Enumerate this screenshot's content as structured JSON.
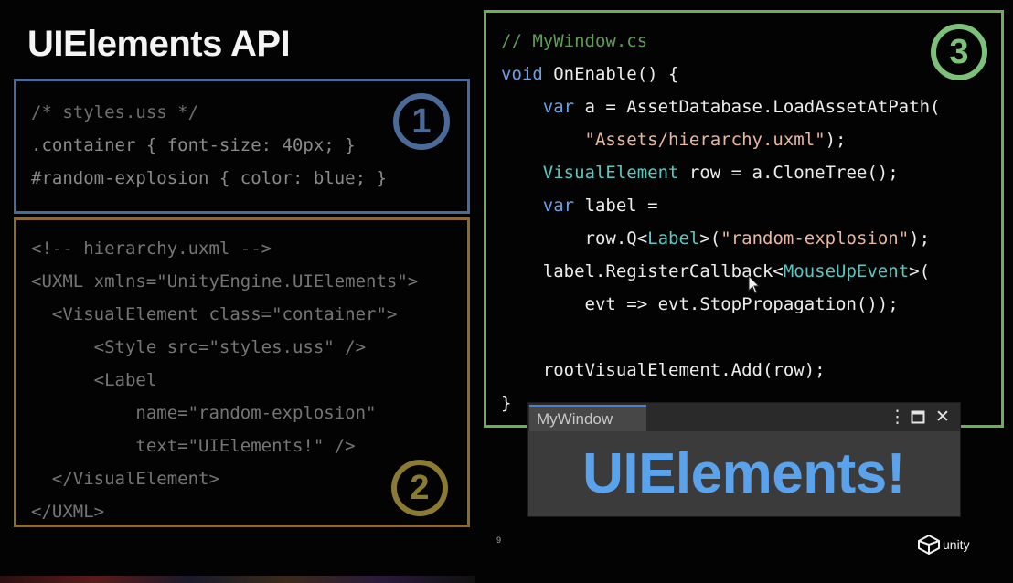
{
  "slide": {
    "title": "UIElements API",
    "page_number": "9"
  },
  "badges": {
    "one": "1",
    "two": "2",
    "three": "3"
  },
  "uss": {
    "line1": "/* styles.uss */",
    "line2": ".container { font-size: 40px; }",
    "line3": "#random-explosion { color: blue; }"
  },
  "uxml": {
    "line1": "<!-- hierarchy.uxml -->",
    "line2": "<UXML xmlns=\"UnityEngine.UIElements\">",
    "line3": "  <VisualElement class=\"container\">",
    "line4": "      <Style src=\"styles.uss\" />",
    "line5": "      <Label",
    "line6": "          name=\"random-explosion\"",
    "line7": "          text=\"UIElements!\" />",
    "line8": "  </VisualElement>",
    "line9": "</UXML>"
  },
  "cs": {
    "comment": "// MyWindow.cs",
    "l2_void": "void",
    "l2_rest": " OnEnable() {",
    "l3_var": "    var",
    "l3_rest": " a = AssetDatabase.LoadAssetAtPath(",
    "l4_str": "        \"Assets/hierarchy.uxml\"",
    "l4_rest": ");",
    "l5_type": "    VisualElement",
    "l5_rest": " row = a.CloneTree();",
    "l6_var": "    var",
    "l6_rest": " label =",
    "l7_pre": "        row.Q<",
    "l7_type": "Label",
    "l7_mid": ">(",
    "l7_str": "\"random-explosion\"",
    "l7_end": ");",
    "l8_pre": "    label.RegisterCallback<",
    "l8_type": "MouseUpEvent",
    "l8_end": ">(",
    "l9": "        evt => evt.StopPropagation());",
    "l10": "",
    "l11": "    rootVisualElement.Add(row);",
    "l12": "}"
  },
  "mywindow": {
    "tab_label": "MyWindow",
    "menu_icon": "⋮",
    "maximize_icon": "🗖",
    "close_icon": "✕",
    "content_text": "UIElements!"
  },
  "logo": {
    "text": "unity"
  },
  "colors": {
    "uss_border": "#4a6a9a",
    "uxml_border": "#8a6a3a",
    "cs_border": "#6cae5c",
    "label_blue": "#5aa3ec"
  }
}
